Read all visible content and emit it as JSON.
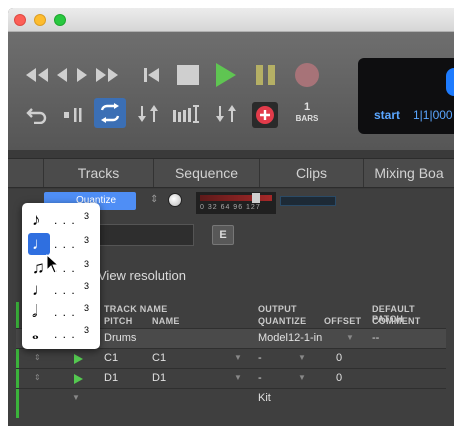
{
  "transport": {
    "loop_bars_num": "1",
    "loop_bars_label": "BARS"
  },
  "counter": {
    "start_label": "start",
    "position": "1|1|000"
  },
  "tabs": [
    "Tracks",
    "Sequence",
    "Clips",
    "Mixing Boa"
  ],
  "quantize": {
    "label": "Quantize",
    "meter_scale": "0 32 64 96 127"
  },
  "edit_button": "E",
  "view_resolution": "View resolution",
  "table": {
    "headers": {
      "track_name": "TRACK NAME",
      "pitch": "PITCH",
      "name": "NAME",
      "output": "OUTPUT",
      "quantize": "QUANTIZE",
      "offset": "OFFSET",
      "default_patch": "DEFAULT PATCH",
      "comment": "COMMENT"
    },
    "rows": [
      {
        "track": "Drums",
        "output": "Model12-1-in",
        "patch": "--"
      },
      {
        "pitch": "C1",
        "name": "C1",
        "quantize": "-",
        "offset": "0"
      },
      {
        "pitch": "D1",
        "name": "D1",
        "quantize": "-",
        "offset": "0"
      },
      {
        "output": "Kit"
      }
    ]
  },
  "resolution_menu": {
    "items": [
      {
        "icon": "eighth-note-icon",
        "glyph": "♪",
        "dots": ". . .",
        "num": "3",
        "selected": false
      },
      {
        "icon": "quarter-note-icon",
        "glyph": "♩",
        "dots": ". . .",
        "num": "3",
        "selected": true
      },
      {
        "icon": "beamed-eighths-icon",
        "glyph": "♫",
        "dots": ". . .",
        "num": "3",
        "selected": false
      },
      {
        "icon": "quarter-note-icon",
        "glyph": "♩",
        "dots": ". . .",
        "num": "3",
        "selected": false
      },
      {
        "icon": "half-note-icon",
        "glyph": "𝅗𝅥",
        "dots": ". . .",
        "num": "3",
        "selected": false
      },
      {
        "icon": "whole-note-icon",
        "glyph": "𝅝",
        "dots": ". . .",
        "num": "3",
        "selected": false
      }
    ]
  },
  "colors": {
    "accent": "#4f8ef5",
    "play_green": "#54c850",
    "record_red": "#e23b4a",
    "counter_blue": "#5aa6ff"
  }
}
